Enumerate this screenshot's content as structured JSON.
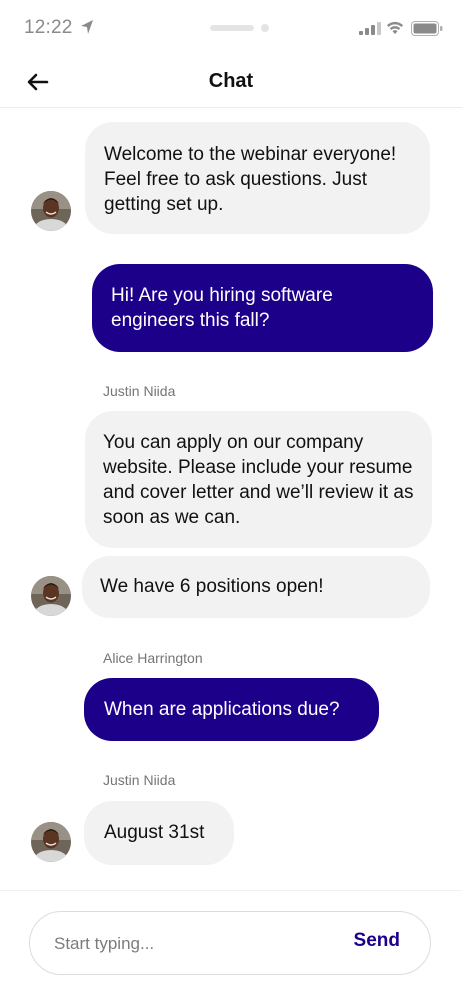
{
  "status_bar": {
    "time": "12:22"
  },
  "header": {
    "title": "Chat"
  },
  "messages": [
    {
      "direction": "incoming",
      "sender": "",
      "text": "Welcome to the webinar everyone! Feel free to ask questions. Just getting set up.",
      "avatar": true
    },
    {
      "direction": "outgoing",
      "text": "Hi! Are you hiring software engineers this fall?"
    },
    {
      "direction": "incoming",
      "sender": "Justin Niida",
      "text": "You can apply on our company website. Please include your resume and cover letter and we’ll review it as soon as we can.",
      "avatar": false
    },
    {
      "direction": "incoming",
      "sender": "",
      "text": "We have 6 positions open!",
      "avatar": true
    },
    {
      "direction": "outgoing",
      "sender": "Alice Harrington",
      "text": "When are applications due?"
    },
    {
      "direction": "incoming",
      "sender": "Justin Niida",
      "text": "August 31st",
      "avatar": true
    }
  ],
  "composer": {
    "placeholder": "Start typing...",
    "send_label": "Send"
  },
  "colors": {
    "outgoing_bubble": "#1d008a",
    "incoming_bubble": "#f2f2f2",
    "send_text": "#1d008a"
  },
  "icons": {
    "back": "arrow-left-icon",
    "location": "location-arrow-icon",
    "signal": "cellular-signal-icon",
    "wifi": "wifi-icon",
    "battery": "battery-icon"
  }
}
